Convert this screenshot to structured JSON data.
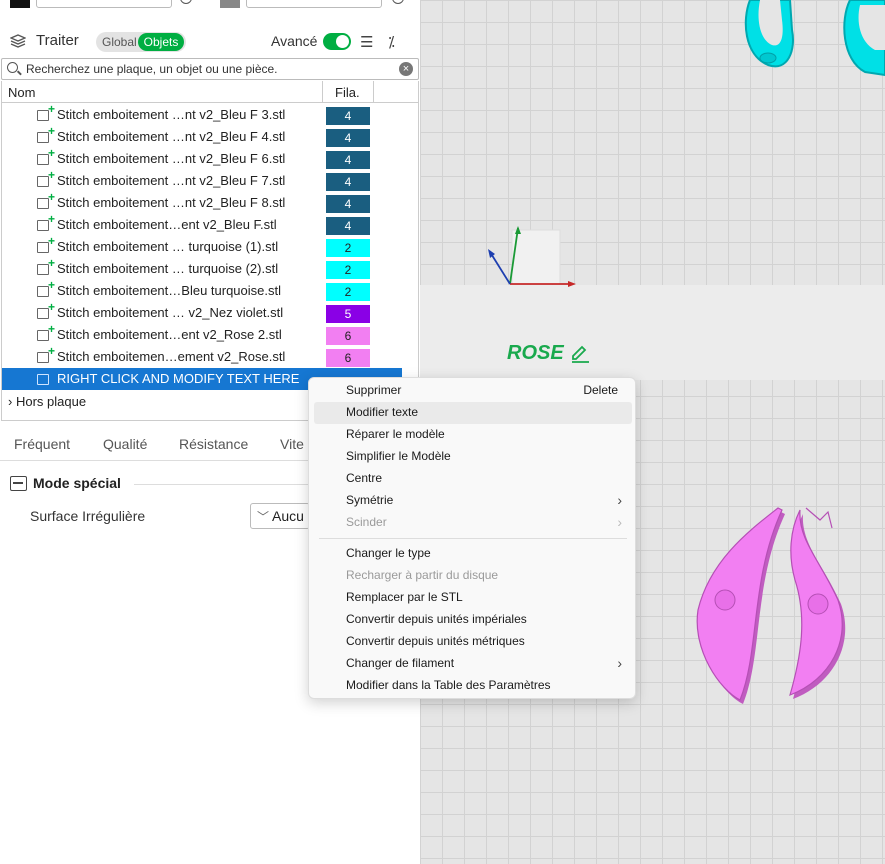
{
  "header": {
    "title": "Traiter",
    "toggle_global": "Global",
    "toggle_objects": "Objets",
    "advanced_label": "Avancé"
  },
  "search": {
    "placeholder": "Recherchez une plaque, un objet ou une pièce."
  },
  "columns": {
    "name": "Nom",
    "filament": "Fila."
  },
  "rows": [
    {
      "label": "Stitch emboitement …nt v2_Bleu F 3.stl",
      "fil": "4",
      "color": "#1a5e80"
    },
    {
      "label": "Stitch emboitement …nt v2_Bleu F 4.stl",
      "fil": "4",
      "color": "#1a5e80"
    },
    {
      "label": "Stitch emboitement …nt v2_Bleu F 6.stl",
      "fil": "4",
      "color": "#1a5e80"
    },
    {
      "label": "Stitch emboitement …nt v2_Bleu F 7.stl",
      "fil": "4",
      "color": "#1a5e80"
    },
    {
      "label": "Stitch emboitement …nt v2_Bleu F 8.stl",
      "fil": "4",
      "color": "#1a5e80"
    },
    {
      "label": "Stitch emboitement…ent v2_Bleu F.stl",
      "fil": "4",
      "color": "#1a5e80"
    },
    {
      "label": "Stitch emboitement … turquoise (1).stl",
      "fil": "2",
      "color": "#00ffff"
    },
    {
      "label": "Stitch emboitement … turquoise (2).stl",
      "fil": "2",
      "color": "#00ffff"
    },
    {
      "label": "Stitch emboitement…Bleu turquoise.stl",
      "fil": "2",
      "color": "#00ffff"
    },
    {
      "label": "Stitch emboitement … v2_Nez violet.stl",
      "fil": "5",
      "color": "#8a00e6"
    },
    {
      "label": "Stitch emboitement…ent v2_Rose 2.stl",
      "fil": "6",
      "color": "#f27ff2"
    },
    {
      "label": "Stitch emboitemen…ement v2_Rose.stl",
      "fil": "6",
      "color": "#f27ff2"
    }
  ],
  "selected_row": {
    "label": "RIGHT CLICK AND MODIFY TEXT HERE"
  },
  "hors_plaque": "Hors plaque",
  "tabs": [
    "Fréquent",
    "Qualité",
    "Résistance",
    "Vite"
  ],
  "special_mode": {
    "title": "Mode spécial",
    "surface_label": "Surface Irrégulière",
    "surface_value": "Aucu"
  },
  "viewport": {
    "text_label": "ROSE"
  },
  "context_menu": {
    "items": [
      {
        "label": "Supprimer",
        "shortcut": "Delete",
        "disabled": false,
        "submenu": false
      },
      {
        "label": "Modifier texte",
        "disabled": false,
        "submenu": false,
        "hover": true
      },
      {
        "label": "Réparer le modèle",
        "disabled": false,
        "submenu": false
      },
      {
        "label": "Simplifier le Modèle",
        "disabled": false,
        "submenu": false
      },
      {
        "label": "Centre",
        "disabled": false,
        "submenu": false
      },
      {
        "label": "Symétrie",
        "disabled": false,
        "submenu": true
      },
      {
        "label": "Scinder",
        "disabled": true,
        "submenu": true
      },
      {
        "label": "Changer le type",
        "disabled": false,
        "submenu": false
      },
      {
        "label": "Recharger à partir du disque",
        "disabled": true,
        "submenu": false
      },
      {
        "label": "Remplacer par le STL",
        "disabled": false,
        "submenu": false
      },
      {
        "label": "Convertir depuis unités impériales",
        "disabled": false,
        "submenu": false
      },
      {
        "label": "Convertir depuis unités métriques",
        "disabled": false,
        "submenu": false
      },
      {
        "label": "Changer de filament",
        "disabled": false,
        "submenu": true
      },
      {
        "label": "Modifier dans la Table des Paramètres",
        "disabled": false,
        "submenu": false
      }
    ]
  },
  "colors": {
    "accent": "#00ae42",
    "selection": "#1677d2",
    "rose_text": "#19a94d"
  }
}
